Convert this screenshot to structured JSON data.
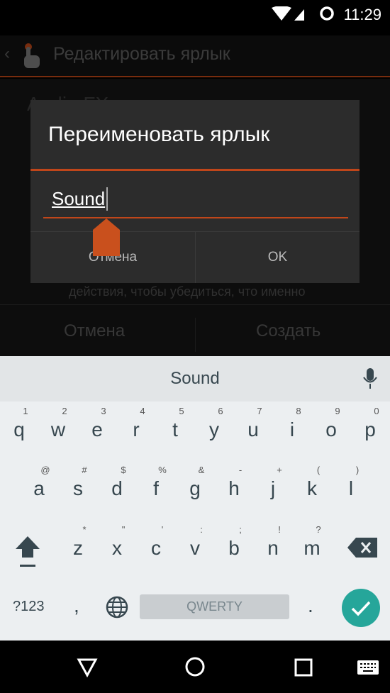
{
  "status_bar": {
    "time": "11:29",
    "icons": [
      "wifi-icon",
      "cell-signal-icon",
      "sync-icon"
    ]
  },
  "action_bar": {
    "title": "Редактировать ярлык",
    "icons": [
      "back-chevron-icon",
      "touch-hand-icon"
    ]
  },
  "background": {
    "app_name": "Audio FX",
    "description": "действия, чтобы убедиться, что именно",
    "cancel": "Отмена",
    "create": "Создать"
  },
  "dialog": {
    "title": "Переименовать ярлык",
    "input_value": "Sound",
    "cancel": "Отмена",
    "ok": "OK",
    "accent": "#c0461a"
  },
  "keyboard": {
    "suggestion": "Sound",
    "row1": [
      [
        "q",
        "1"
      ],
      [
        "w",
        "2"
      ],
      [
        "e",
        "3"
      ],
      [
        "r",
        "4"
      ],
      [
        "t",
        "5"
      ],
      [
        "y",
        "6"
      ],
      [
        "u",
        "7"
      ],
      [
        "i",
        "8"
      ],
      [
        "o",
        "9"
      ],
      [
        "p",
        "0"
      ]
    ],
    "row2": [
      [
        "a",
        "@"
      ],
      [
        "s",
        "#"
      ],
      [
        "d",
        "$"
      ],
      [
        "f",
        "%"
      ],
      [
        "g",
        "&"
      ],
      [
        "h",
        "-"
      ],
      [
        "j",
        "+"
      ],
      [
        "k",
        "("
      ],
      [
        "l",
        ")"
      ]
    ],
    "row3": [
      [
        "z",
        "*"
      ],
      [
        "x",
        "\""
      ],
      [
        "c",
        "'"
      ],
      [
        "v",
        ":"
      ],
      [
        "b",
        ";"
      ],
      [
        "n",
        "!"
      ],
      [
        "m",
        "?"
      ]
    ],
    "symbols": "?123",
    "comma": ",",
    "space": "QWERTY",
    "period": ".",
    "accent": "#26a69a"
  }
}
